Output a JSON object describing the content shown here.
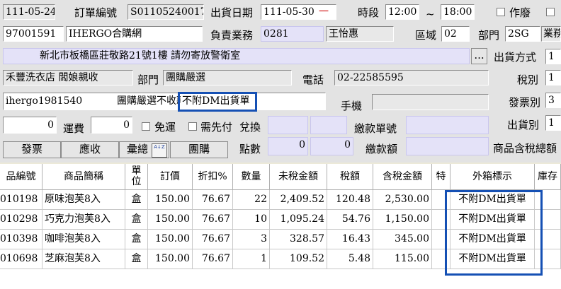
{
  "header": {
    "doc_date": "111-05-24",
    "order_no_label": "訂單編號",
    "order_no": "S01105240017",
    "ship_date_label": "出貨日期",
    "ship_date": "111-05-30",
    "ship_date_mark": "一",
    "time_label": "時段",
    "time_from": "12:00",
    "time_sep": "~",
    "time_to": "18:00",
    "void_label": "作廢",
    "customer_code": "97001591",
    "customer_name": "IHERGO合購網",
    "sales_label": "負責業務",
    "sales_code": "0281",
    "sales_name": "王怡惠",
    "region_label": "區域",
    "region": "02",
    "dept_label": "部門",
    "dept": "2SG",
    "dept_name_cut": "業務",
    "address": "新北市板橋區莊敬路21號1樓 請勿寄放警衛室",
    "address_btn": "...",
    "ship_method_label": "出貨方式",
    "ship_method": "1",
    "store_name": "禾豐洗衣店 闆娘親收",
    "dept2_label": "部門",
    "dept2": "團購嚴選",
    "phone_label": "電話",
    "phone": "02-22585595",
    "tax_label": "稅別",
    "tax": "1",
    "account": "ihergo1981540",
    "remark": "團購嚴選不收款",
    "note": "不附DM出貨單",
    "mobile_label": "手機",
    "invoice_type_label": "發票別",
    "invoice_type": "3",
    "val_left": "0",
    "freight_label": "運費",
    "freight": "0",
    "free_ship_label": "免運",
    "prepay_label": "需先付",
    "exchange_label": "兌換",
    "payment_no_label": "繳款單號",
    "ship_type_label": "出貨別",
    "ship_type": "1",
    "points_label": "點數",
    "points1": "0",
    "points2": "0",
    "payment_amt_label": "繳款額",
    "total_label": "商品含稅總額"
  },
  "buttons": {
    "invoice": "發票",
    "receivable": "應收",
    "summary": "彙總",
    "summary_icon": "A↓Z",
    "group_buy": "團購"
  },
  "table": {
    "columns": [
      "品編號",
      "商品簡稱",
      "單位",
      "訂價",
      "折扣%",
      "數量",
      "未稅金額",
      "稅額",
      "含稅金額",
      "特",
      "外箱標示",
      "庫存"
    ],
    "rows": [
      [
        "010198",
        "原味泡芙8入",
        "盒",
        "150.00",
        "76.67",
        "22",
        "2,409.52",
        "120.48",
        "2,530.00",
        "",
        "不附DM出貨單",
        ""
      ],
      [
        "010298",
        "巧克力泡芙8入",
        "盒",
        "150.00",
        "76.67",
        "10",
        "1,095.24",
        "54.76",
        "1,150.00",
        "",
        "不附DM出貨單",
        ""
      ],
      [
        "010398",
        "咖啡泡芙8入",
        "盒",
        "150.00",
        "76.67",
        "3",
        "328.57",
        "16.43",
        "345.00",
        "",
        "不附DM出貨單",
        ""
      ],
      [
        "010698",
        "芝麻泡芙8入",
        "盒",
        "150.00",
        "76.67",
        "1",
        "109.52",
        "5.48",
        "115.00",
        "",
        "不附DM出貨單",
        ""
      ]
    ]
  },
  "colors": {
    "highlight": "#1550b4",
    "form_bg": "#e3e3e3",
    "field_purple": "#e4e2f8",
    "mark_red": "#d01010"
  }
}
